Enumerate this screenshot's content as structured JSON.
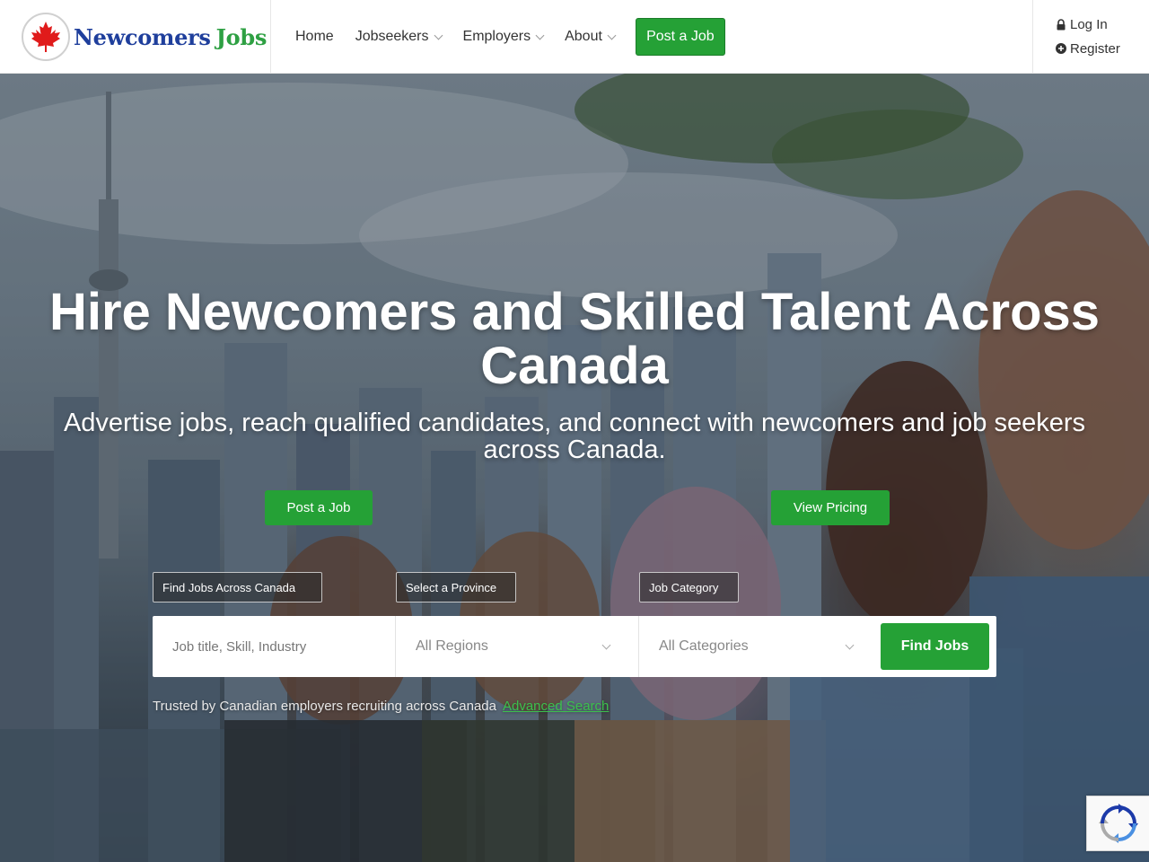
{
  "brand": {
    "name_blue": "Newcomers",
    "name_green": "Jobs",
    "logo_icon": "maple-leaf-icon",
    "colors": {
      "blue": "#1f3f9c",
      "green": "#2ea043",
      "red": "#e01b1b"
    }
  },
  "nav": {
    "items": [
      {
        "label": "Home",
        "dropdown": false
      },
      {
        "label": "Jobseekers",
        "dropdown": true
      },
      {
        "label": "Employers",
        "dropdown": true
      },
      {
        "label": "About",
        "dropdown": true
      }
    ],
    "post_job": "Post a Job"
  },
  "auth": {
    "login": "Log In",
    "login_icon": "lock-icon",
    "register": "Register",
    "register_icon": "plus-circle-icon"
  },
  "hero": {
    "title": "Hire Newcomers and Skilled Talent Across Canada",
    "subtitle": "Advertise jobs, reach qualified candidates, and connect with newcomers and job seekers across Canada.",
    "post_button": "Post a Job",
    "pricing_button": "View Pricing",
    "accent": "#25a136"
  },
  "search": {
    "tags": [
      "Find Jobs Across Canada",
      "Select a Province",
      "Job Category"
    ],
    "keyword_placeholder": "Job title, Skill, Industry",
    "region_selected": "All Regions",
    "category_selected": "All Categories",
    "submit": "Find Jobs"
  },
  "footer_line": {
    "trusted": "Trusted by Canadian employers recruiting across Canada",
    "advanced": "Advanced Search"
  },
  "recaptcha": {
    "icon": "recaptcha-icon"
  }
}
